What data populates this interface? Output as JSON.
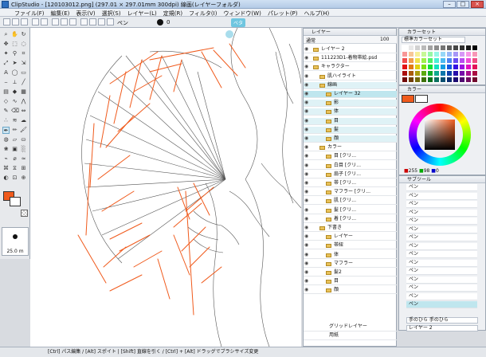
{
  "window": {
    "title": "ClipStudio - [120103012.png] (297.01 × 297.01mm 300dpi) 線画(レイヤーフォルダ)",
    "min_label": "–",
    "max_label": "□",
    "close_label": "×"
  },
  "menu": [
    "ファイル(F)",
    "編集(E)",
    "表示(V)",
    "選択(S)",
    "レイヤー(L)",
    "定規(R)",
    "フィルタ(I)",
    "ウィンドウ(W)",
    "パレット(P)",
    "ヘルプ(H)"
  ],
  "toolbar": {
    "tool_label": "ペン",
    "size_value": "0",
    "badge": "ベタ"
  },
  "toolbox": {
    "brush_size": "25.0 m"
  },
  "layers": {
    "panel_title": "レイヤー",
    "blend_mode": "通常",
    "opacity": "100",
    "rows": [
      {
        "label": "レイヤー 2",
        "indent": 0,
        "state": "normal"
      },
      {
        "label": "111223D1-着物帯絵.psd",
        "indent": 0,
        "state": "normal"
      },
      {
        "label": "キャラクター",
        "indent": 0,
        "state": "normal"
      },
      {
        "label": "肌ハイライト",
        "indent": 1,
        "state": "normal"
      },
      {
        "label": "線画",
        "indent": 1,
        "state": "hl"
      },
      {
        "label": "レイヤー 32",
        "indent": 2,
        "state": "sel"
      },
      {
        "label": "影",
        "indent": 2,
        "state": "hl"
      },
      {
        "label": "体",
        "indent": 2,
        "state": "hl"
      },
      {
        "label": "目",
        "indent": 2,
        "state": "hl"
      },
      {
        "label": "髪",
        "indent": 2,
        "state": "hl"
      },
      {
        "label": "顔",
        "indent": 2,
        "state": "hl"
      },
      {
        "label": "カラー",
        "indent": 1,
        "state": "normal"
      },
      {
        "label": "目 [クリ...",
        "indent": 2,
        "state": "normal"
      },
      {
        "label": "白目 [クリ...",
        "indent": 2,
        "state": "normal"
      },
      {
        "label": "扇子 [クリ...",
        "indent": 2,
        "state": "normal"
      },
      {
        "label": "帯 [クリ...",
        "indent": 2,
        "state": "normal"
      },
      {
        "label": "マフラー [クリ...",
        "indent": 2,
        "state": "normal"
      },
      {
        "label": "肌 [クリ...",
        "indent": 2,
        "state": "normal"
      },
      {
        "label": "髪 [クリ...",
        "indent": 2,
        "state": "normal"
      },
      {
        "label": "着 [クリ...",
        "indent": 2,
        "state": "normal"
      },
      {
        "label": "下書き",
        "indent": 1,
        "state": "normal"
      },
      {
        "label": "レイヤー",
        "indent": 2,
        "state": "normal"
      },
      {
        "label": "帯紐",
        "indent": 2,
        "state": "normal"
      },
      {
        "label": "体",
        "indent": 2,
        "state": "normal"
      },
      {
        "label": "マフラー",
        "indent": 2,
        "state": "normal"
      },
      {
        "label": "髪2",
        "indent": 2,
        "state": "normal"
      },
      {
        "label": "目",
        "indent": 2,
        "state": "normal"
      },
      {
        "label": "顔",
        "indent": 2,
        "state": "normal"
      }
    ],
    "footer_rows": [
      "グリッドレイヤー",
      "用紙"
    ]
  },
  "colorset": {
    "panel_title": "カラーセット",
    "set_name": "標準カラーセット"
  },
  "colorwheel": {
    "panel_title": "カラー",
    "r": "255",
    "g": "98",
    "b": "0"
  },
  "subtool": {
    "panel_title": "サブツール",
    "items": [
      "ペン",
      "ペン",
      "ペン",
      "ペン",
      "ペン",
      "ペン",
      "ペン",
      "ペン",
      "ペン",
      "ペン",
      "ペン",
      "ペン",
      "ペン",
      "ペン",
      "ペン"
    ],
    "layer_name": "レイヤー 2",
    "tool_name": "手のひら 手のひら"
  },
  "status": {
    "text": "[Ctrl] パス編集 / [Alt] スポイト | [Shift] 直線を引く / [Ctrl] + [Alt] ドラッグでブラシサイズ変更"
  },
  "colors": {
    "accent": "#f05a1c",
    "selection": "#bfe6ee",
    "title_gradient_top": "#cfe0f3"
  }
}
